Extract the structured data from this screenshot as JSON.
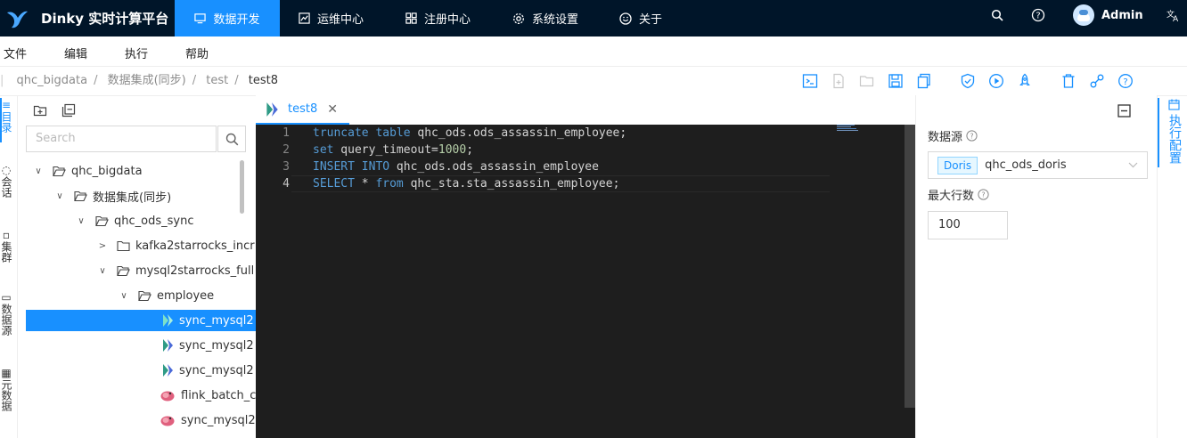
{
  "app": {
    "title": "Dinky 实时计算平台",
    "user": "Admin",
    "nav": [
      {
        "label": "数据开发",
        "active": true,
        "icon": "monitor-icon"
      },
      {
        "label": "运维中心",
        "active": false,
        "icon": "chart-box-icon"
      },
      {
        "label": "注册中心",
        "active": false,
        "icon": "grid-icon"
      },
      {
        "label": "系统设置",
        "active": false,
        "icon": "gear-icon"
      },
      {
        "label": "关于",
        "active": false,
        "icon": "smile-icon"
      }
    ]
  },
  "menubar": [
    "文件",
    "编辑",
    "执行",
    "帮助"
  ],
  "breadcrumb": [
    "qhc_bigdata",
    "数据集成(同步)",
    "test",
    "test8"
  ],
  "left_rail": {
    "catalog": "目录",
    "session": "会话",
    "cluster": "集群",
    "datasource": "数据源",
    "metadata": "元数据"
  },
  "tree": {
    "search_placeholder": "Search",
    "nodes": [
      {
        "label": "qhc_bigdata",
        "type": "folder",
        "expanded": true
      },
      {
        "label": "数据集成(同步)",
        "type": "folder",
        "expanded": true
      },
      {
        "label": "qhc_ods_sync",
        "type": "folder",
        "expanded": true
      },
      {
        "label": "kafka2starrocks_incr",
        "type": "folder",
        "expanded": false
      },
      {
        "label": "mysql2starrocks_full",
        "type": "folder",
        "expanded": true
      },
      {
        "label": "employee",
        "type": "folder",
        "expanded": true
      },
      {
        "label": "sync_mysql2",
        "type": "flinksql",
        "selected": true
      },
      {
        "label": "sync_mysql2",
        "type": "flinksql"
      },
      {
        "label": "sync_mysql2",
        "type": "flinksql"
      },
      {
        "label": "flink_batch_c",
        "type": "flink"
      },
      {
        "label": "sync_mysql2",
        "type": "flink"
      }
    ]
  },
  "editor": {
    "tab_label": "test8",
    "current_line": 4,
    "lines": [
      [
        "truncate table",
        " qhc_ods.ods_assassin_employee;"
      ],
      [
        "set",
        " query_timeout=",
        "1000",
        ";"
      ],
      [
        "INSERT INTO",
        " qhc_ods.ods_assassin_employee"
      ],
      [
        "SELECT",
        " * ",
        "from",
        " qhc_sta.sta_assassin_employee;"
      ]
    ]
  },
  "config": {
    "datasource_label": "数据源",
    "datasource_tag": "Doris",
    "datasource_value": "qhc_ods_doris",
    "maxrows_label": "最大行数",
    "maxrows_value": "100"
  },
  "right_rail": {
    "label": "执行配置"
  },
  "colors": {
    "nav_bg": "#001529",
    "accent": "#1890ff",
    "editor_bg": "#1e1e1e"
  }
}
